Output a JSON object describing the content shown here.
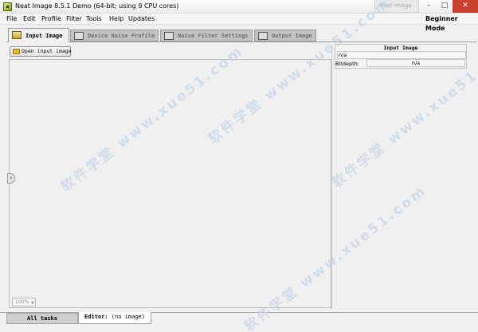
{
  "window": {
    "title": "Neat Image 8.5.1 Demo (64-bit; using 9 CPU cores)",
    "ghost_tab": "Neat Image"
  },
  "menu": {
    "items": [
      "File",
      "Edit",
      "Profile",
      "Filter",
      "Tools",
      "Help",
      "Updates"
    ],
    "mode": "Beginner Mode"
  },
  "tabs": [
    {
      "label": "Input Image",
      "active": true
    },
    {
      "label": "Device Noise Profile",
      "active": false
    },
    {
      "label": "Noise Filter Settings",
      "active": false
    },
    {
      "label": "Output Image",
      "active": false
    }
  ],
  "input_panel": {
    "open_button": "Open input image",
    "zoom": "100%"
  },
  "info": {
    "title": "Input Image",
    "name": "n/a",
    "bitdepth_label": "Bitdepth:",
    "bitdepth_value": "n/a"
  },
  "bottom_tabs": {
    "all_tasks": "All tasks",
    "editor_label": "Editor:",
    "editor_state": "(no image)"
  },
  "watermark": "软件学堂 www.xue51.com",
  "colors": {
    "close_button": "#c8422f",
    "inactive_tab": "#c3c3c3",
    "watermark": "#c7d6e8"
  }
}
